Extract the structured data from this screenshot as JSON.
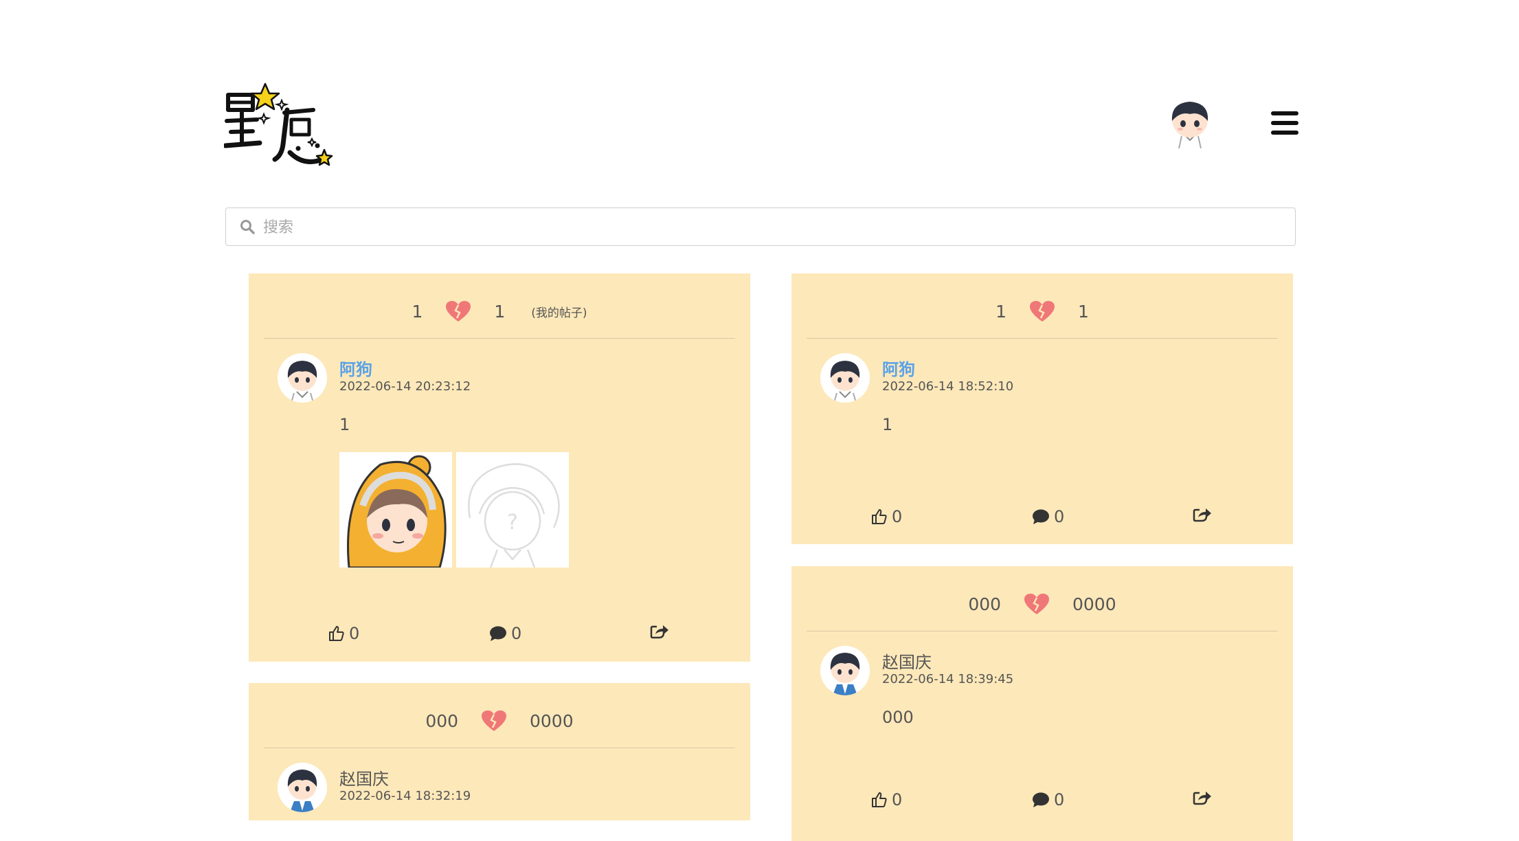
{
  "header": {
    "logo_text": "星愿"
  },
  "search": {
    "placeholder": "搜索"
  },
  "posts": [
    {
      "count_left": "1",
      "count_right": "1",
      "tag": "(我的帖子)",
      "author": "阿狗",
      "time": "2022-06-14 20:23:12",
      "content": "1",
      "likes": "0",
      "comments": "0"
    },
    {
      "count_left": "000",
      "count_right": "0000",
      "author": "赵国庆",
      "time": "2022-06-14 18:32:19"
    },
    {
      "count_left": "1",
      "count_right": "1",
      "author": "阿狗",
      "time": "2022-06-14 18:52:10",
      "content": "1",
      "likes": "0",
      "comments": "0"
    },
    {
      "count_left": "000",
      "count_right": "0000",
      "author": "赵国庆",
      "time": "2022-06-14 18:39:45",
      "content": "000",
      "likes": "0",
      "comments": "0"
    }
  ],
  "colors": {
    "card_bg": "#fde8b9",
    "author_link": "#5aa2e8",
    "heart": "#f07777"
  }
}
